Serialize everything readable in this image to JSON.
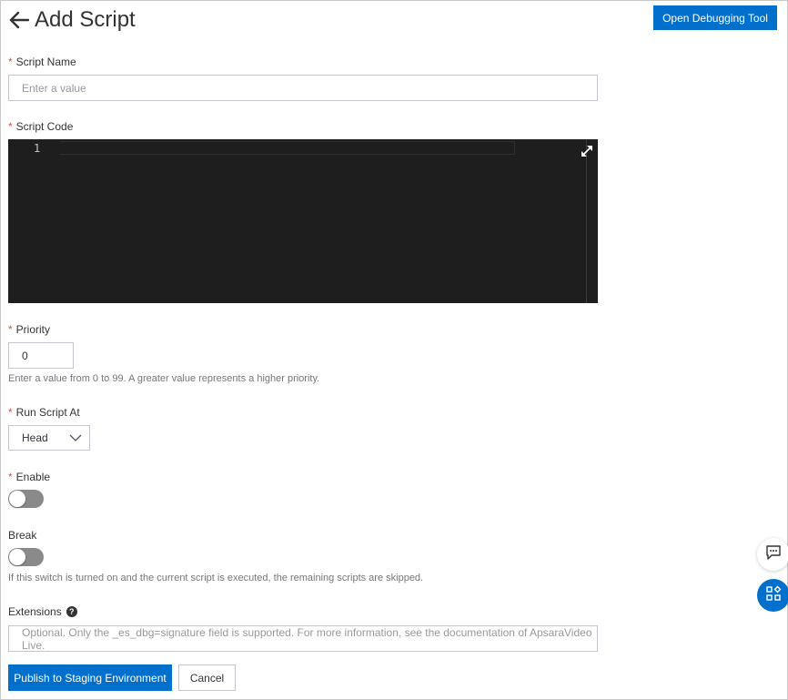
{
  "header": {
    "title": "Add Script",
    "debug_button": "Open Debugging Tool"
  },
  "form": {
    "script_name": {
      "label": "Script Name",
      "required_mark": "*",
      "placeholder": "Enter a value",
      "value": ""
    },
    "script_code": {
      "label": "Script Code",
      "required_mark": "*",
      "line_number": "1"
    },
    "priority": {
      "label": "Priority",
      "required_mark": "*",
      "value": "0",
      "hint": "Enter a value from 0 to 99. A greater value represents a higher priority."
    },
    "run_script_at": {
      "label": "Run Script At",
      "required_mark": "*",
      "selected": "Head"
    },
    "enable": {
      "label": "Enable",
      "required_mark": "*",
      "on": false
    },
    "break": {
      "label": "Break",
      "on": false,
      "hint": "If this switch is turned on and the current script is executed, the remaining scripts are skipped."
    },
    "extensions": {
      "label": "Extensions",
      "help": "?",
      "placeholder": "Optional. Only the _es_dbg=signature field is supported. For more information, see the documentation of ApsaraVideo Live."
    }
  },
  "footer": {
    "publish_button": "Publish to Staging Environment",
    "cancel_button": "Cancel"
  },
  "icons": {
    "back": "arrow-left-icon",
    "expand": "expand-icon",
    "chevron": "chevron-down-icon",
    "chat": "chat-icon",
    "apps": "apps-icon"
  },
  "colors": {
    "primary": "#0070cc",
    "required": "#e14f3c",
    "editor_bg": "#1e1e1e",
    "toggle_off": "#8a8a8a"
  }
}
